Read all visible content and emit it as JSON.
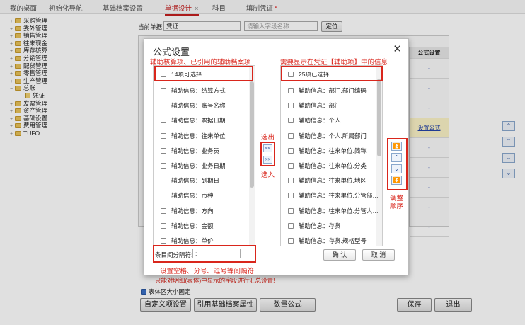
{
  "tabs": [
    {
      "label": "我的桌面",
      "active": false
    },
    {
      "label": "初始化导航",
      "active": false
    },
    {
      "label": "基础档案设置",
      "active": false
    },
    {
      "label": "单据设计",
      "active": true,
      "close": "×"
    },
    {
      "label": "科目",
      "active": false
    },
    {
      "label": "填制凭证",
      "active": false,
      "modified": "*"
    }
  ],
  "tree": [
    {
      "label": "采购管理",
      "expand": "+"
    },
    {
      "label": "委外管理",
      "expand": "+"
    },
    {
      "label": "销售管理",
      "expand": "+"
    },
    {
      "label": "往来现金",
      "expand": "+"
    },
    {
      "label": "库存核算",
      "expand": "+"
    },
    {
      "label": "分销管理",
      "expand": "+"
    },
    {
      "label": "配货管理",
      "expand": "+"
    },
    {
      "label": "零售管理",
      "expand": "+"
    },
    {
      "label": "生产管理",
      "expand": "+"
    },
    {
      "label": "总账",
      "expand": "−"
    },
    {
      "label": "凭证",
      "child": true
    },
    {
      "label": "发票管理",
      "expand": "+"
    },
    {
      "label": "资产管理",
      "expand": "+"
    },
    {
      "label": "基础设置",
      "expand": "+"
    },
    {
      "label": "费用管理",
      "expand": "+"
    },
    {
      "label": "TUFO",
      "expand": "+"
    }
  ],
  "main": {
    "current_doc_label": "当前单据",
    "current_doc_value": "凭证",
    "field_search_placeholder": "请输入字段名称",
    "locate_button": "定位",
    "formula_header": "公式设置",
    "formula_cells": [
      "-",
      "-",
      "-",
      "设置公式",
      "-",
      "-",
      "-",
      "-",
      "-"
    ],
    "fixed_size_label": "表体区大小固定",
    "note_text": "只能对明细(表体)中显示的字段进行汇总设置!",
    "buttons": {
      "custom_items": "自定义项设置",
      "ref_archive": "引用基础档案属性",
      "qty_formula": "数量公式",
      "save": "保存",
      "exit": "退出"
    },
    "side_arrows": [
      "⌃",
      "⌃",
      "⌄",
      "⌄"
    ]
  },
  "dialog": {
    "title": "公式设置",
    "close": "✕",
    "annotations": {
      "left_top": "辅助核算项、已引用的辅助档案项",
      "right_top": "需要显示在凭证【辅助项】中的信息",
      "move_out": "选出",
      "move_in": "选入",
      "order": "调整\n顺序",
      "separator_hint": "设置空格、分号、逗号等间隔符"
    },
    "left_list": {
      "header": "14项可选择",
      "items": [
        "辅助信息：结算方式",
        "辅助信息：账号名称",
        "辅助信息：票据日期",
        "辅助信息：往来单位",
        "辅助信息：业务员",
        "辅助信息：业务日期",
        "辅助信息：到期日",
        "辅助信息：币种",
        "辅助信息：方向",
        "辅助信息：金额",
        "辅助信息：单价"
      ]
    },
    "right_list": {
      "header": "25项已选择",
      "items": [
        "辅助信息：部门.部门编码",
        "辅助信息：部门",
        "辅助信息：个人",
        "辅助信息：个人.所属部门",
        "辅助信息：往来单位.简称",
        "辅助信息：往来单位.分类",
        "辅助信息：往来单位.地区",
        "辅助信息：往来单位.分管部…",
        "辅助信息：往来单位.分管人…",
        "辅助信息：存货",
        "辅助信息：存货.规格型号"
      ]
    },
    "move_buttons": [
      "<<",
      ">>"
    ],
    "order_buttons": [
      "⏫",
      "⌃",
      "⌄",
      "⏬"
    ],
    "separator_label": "条目间分隔符:",
    "separator_value": ";",
    "ok_button": "确 认",
    "cancel_button": "取 消",
    "colors": {
      "accent_red": "#d9261c",
      "link_blue": "#2544a8"
    }
  }
}
